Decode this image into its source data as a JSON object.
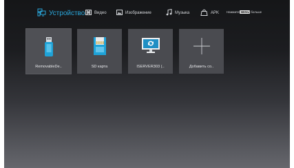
{
  "nav": {
    "tabs": [
      {
        "label": "Устройство",
        "icon": "device-icon",
        "active": true
      },
      {
        "label": "Видео",
        "icon": "film-icon",
        "active": false
      },
      {
        "label": "Изображение",
        "icon": "image-icon",
        "active": false
      },
      {
        "label": "Музыка",
        "icon": "music-note-icon",
        "active": false
      },
      {
        "label": "APK",
        "icon": "bag-icon",
        "active": false
      }
    ],
    "hint": {
      "before": "Нажмите",
      "key": "MENU",
      "after": "больше"
    }
  },
  "devices": [
    {
      "label": "RemovableDe..",
      "icon": "usb-drive-icon"
    },
    {
      "label": "SD карта",
      "icon": "sd-card-icon"
    },
    {
      "label": "ISERVER303 (..",
      "icon": "network-monitor-icon"
    },
    {
      "label": "Добавить со..",
      "icon": "plus-icon"
    }
  ],
  "colors": {
    "accent": "#2aa7dc",
    "tile": "#4a4b50",
    "text": "#d4d6da"
  }
}
